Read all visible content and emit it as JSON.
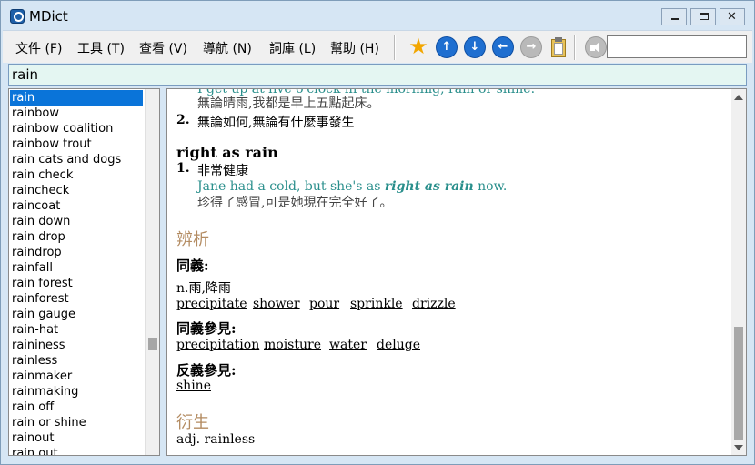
{
  "window": {
    "title": "MDict",
    "app_icon": "mdict-icon"
  },
  "menu": {
    "file": "文件 (F)",
    "tools": "工具 (T)",
    "view": "查看 (V)",
    "navigate": "導航 (N)",
    "library": "詞庫 (L)",
    "help": "幫助 (H)"
  },
  "toolbar": {
    "icons": [
      "star-icon",
      "arrow-up-icon",
      "arrow-down-icon",
      "arrow-back-icon",
      "arrow-forward-icon",
      "clipboard-icon",
      "speaker-icon"
    ],
    "search_value": ""
  },
  "search": {
    "value": "rain"
  },
  "wordlist": {
    "selected": "rain",
    "items": [
      "rain",
      "rainbow",
      "rainbow coalition",
      "rainbow trout",
      "rain cats and dogs",
      "rain check",
      "raincheck",
      "raincoat",
      "rain down",
      "rain drop",
      "raindrop",
      "rainfall",
      "rain forest",
      "rainforest",
      "rain gauge",
      "rain-hat",
      "raininess",
      "rainless",
      "rainmaker",
      "rainmaking",
      "rain off",
      "rain or shine",
      "rainout",
      "rain out"
    ]
  },
  "content": {
    "cut_line": "I get up at five o'clock in the morning, rain or shine.",
    "cut_translation": "無論晴雨,我都是早上五點起床。",
    "sense2_num": "2.",
    "sense2_def": "無論如何,無論有什麼事發生",
    "phrase": "right as rain",
    "phrase_num": "1.",
    "phrase_def": "非常健康",
    "example_pre": "Jane had a cold, but she's as ",
    "example_em": "right as rain",
    "example_post": " now.",
    "example_zh": "珍得了感冒,可是她現在完全好了。",
    "section_analysis": "辨析",
    "synonym_label": "同義:",
    "synonym_def": "n.雨,降雨",
    "synonyms": [
      "precipitate",
      "shower",
      "pour",
      "sprinkle",
      "drizzle"
    ],
    "see_also_label": "同義參見:",
    "see_also": [
      "precipitation",
      "moisture",
      "water",
      "deluge"
    ],
    "antonym_label": "反義參見:",
    "antonyms": [
      "shine"
    ],
    "section_derivation": "衍生",
    "derivation": "adj. rainless"
  }
}
